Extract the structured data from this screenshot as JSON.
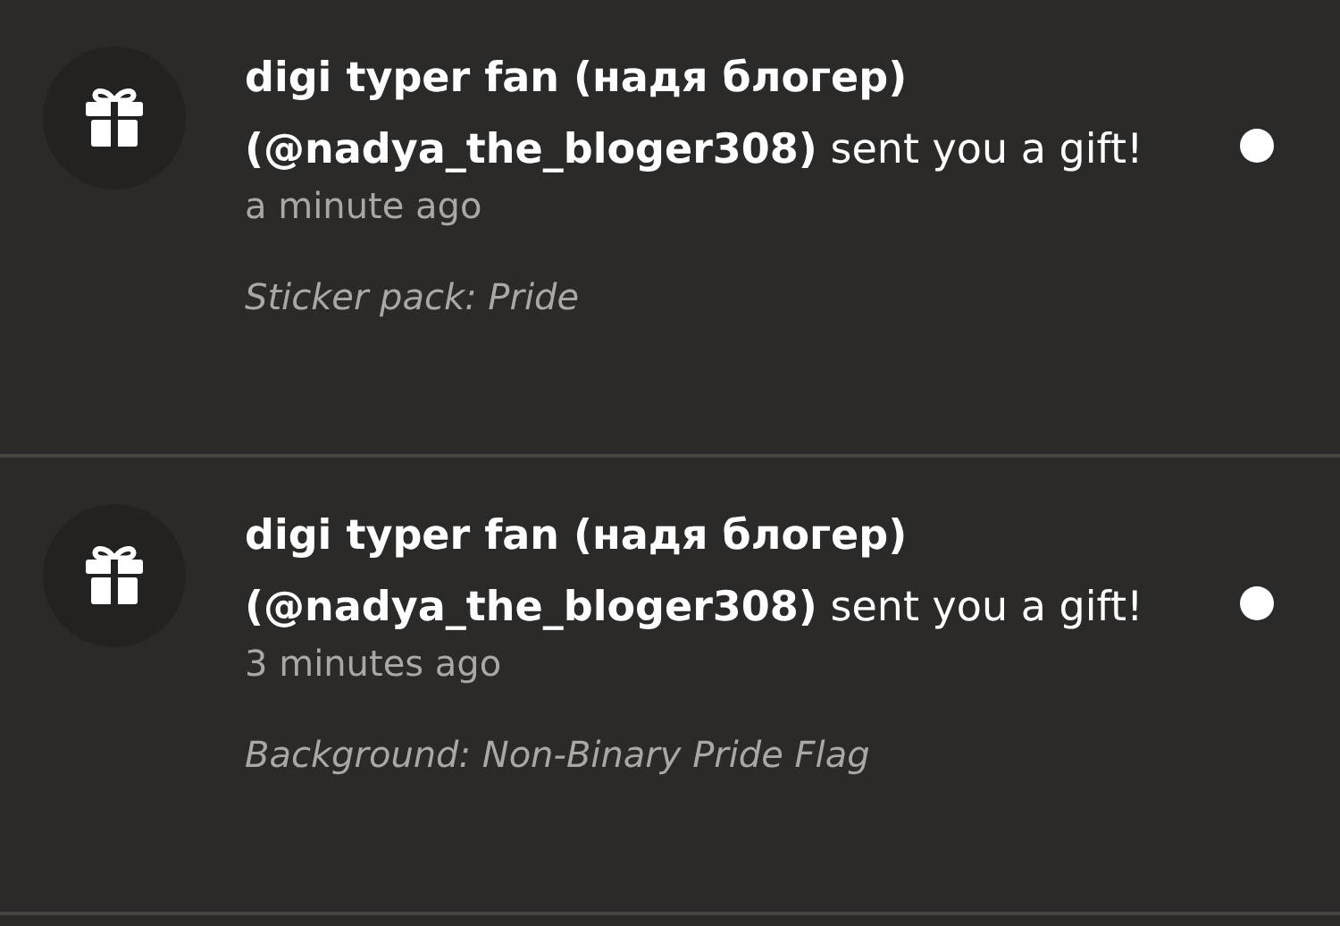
{
  "notifications": [
    {
      "message": "**digi typer fan (надя блогер) (@nadya_the_bloger308)** sent you a gift!",
      "time": "a minute ago",
      "detail": "Sticker pack: Pride",
      "unread": true
    },
    {
      "message": "**digi typer fan (надя блогер) (@nadya_the_bloger308)** sent you a gift!",
      "time": "3 minutes ago",
      "detail": "Background: Non-Binary Pride Flag",
      "unread": true
    }
  ]
}
